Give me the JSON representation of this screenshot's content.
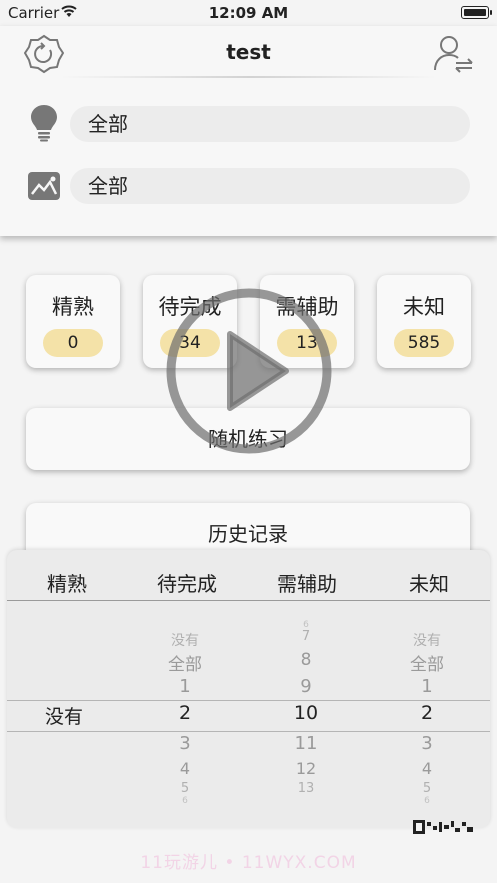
{
  "status_bar": {
    "carrier": "Carrier",
    "time": "12:09 AM"
  },
  "header": {
    "title": "test"
  },
  "filters": [
    {
      "icon": "lightbulb-icon",
      "value": "全部"
    },
    {
      "icon": "image-icon",
      "value": "全部"
    }
  ],
  "stats": [
    {
      "label": "精熟",
      "count": "0"
    },
    {
      "label": "待完成",
      "count": "34"
    },
    {
      "label": "需辅助",
      "count": "13"
    },
    {
      "label": "未知",
      "count": "585"
    }
  ],
  "buttons": {
    "random": "随机练习",
    "history": "历史记录"
  },
  "picker": {
    "headers": [
      "精熟",
      "待完成",
      "需辅助",
      "未知"
    ],
    "col1_selected": "没有",
    "col2": {
      "above": [
        "没有",
        "全部",
        "1"
      ],
      "selected": "2",
      "below": [
        "3",
        "4",
        "5",
        "6"
      ]
    },
    "col3": {
      "above": [
        "6",
        "7",
        "8",
        "9"
      ],
      "selected": "10",
      "below": [
        "11",
        "12",
        "13"
      ]
    },
    "col4": {
      "above": [
        "没有",
        "全部",
        "1"
      ],
      "selected": "2",
      "below": [
        "3",
        "4",
        "5",
        "6"
      ]
    }
  },
  "watermark": "11玩游儿 • 11WYX.COM",
  "colors": {
    "badge": "#f4e2a8",
    "background": "#f4f4f4"
  }
}
